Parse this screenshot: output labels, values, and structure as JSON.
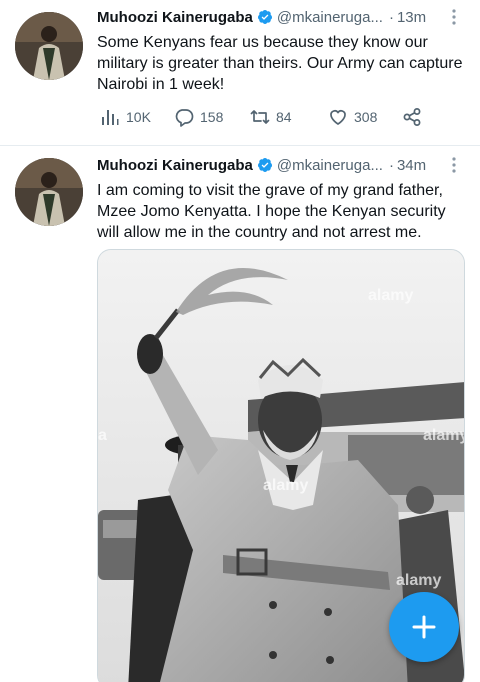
{
  "tweets": [
    {
      "author_name": "Muhoozi Kainerugaba",
      "handle": "@mkaineruga...",
      "separator": "·",
      "time": "13m",
      "text": "Some Kenyans fear us because they know our military is greater than theirs. Our Army can capture Nairobi in 1 week!",
      "views": "10K",
      "replies": "158",
      "retweets": "84",
      "likes": "308"
    },
    {
      "author_name": "Muhoozi Kainerugaba",
      "handle": "@mkaineruga...",
      "separator": "·",
      "time": "34m",
      "text": "I am coming to visit the grave of my grand father, Mzee Jomo Kenyatta. I hope the Kenyan security will allow me in the country and not arrest me.",
      "media": {
        "watermarks": [
          "alamy",
          "alamy",
          "alamy",
          "alamy",
          "a"
        ]
      }
    }
  ],
  "colors": {
    "accent": "#1d9bf0",
    "text_primary": "#0f1419",
    "text_secondary": "#536471"
  },
  "icons": {
    "verified": "verified-badge-icon",
    "views": "bar-chart-icon",
    "reply": "reply-bubble-icon",
    "retweet": "retweet-icon",
    "like": "heart-icon",
    "share": "share-icon",
    "more": "more-vertical-icon",
    "compose": "plus-icon"
  }
}
